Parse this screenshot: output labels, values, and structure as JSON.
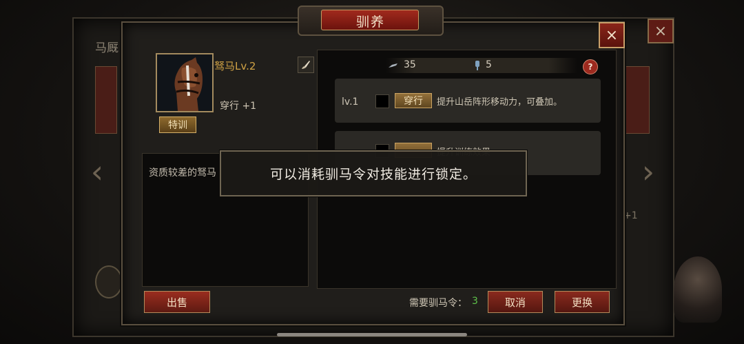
{
  "background": {
    "title": "马厩",
    "close_icon": "×",
    "left_arrow": "‹",
    "right_arrow": "›",
    "stat_fragment": "+1"
  },
  "dialog": {
    "title": "驯养",
    "close_icon": "×"
  },
  "horse": {
    "name": "驽马Lv.2",
    "stat": "穿行 +1",
    "special_button": "特训",
    "description": "资质较差的驽马"
  },
  "resources": [
    {
      "icon": "whip-icon",
      "value": "35"
    },
    {
      "icon": "token-icon",
      "value": "5"
    }
  ],
  "help_icon": "?",
  "brush_icon": "edit-brush-icon",
  "skills": [
    {
      "level": "lv.1",
      "name": "穿行",
      "description": "提升山岳阵形移动力，可叠加。"
    },
    {
      "level": "",
      "name": "",
      "description": "提升训练效果"
    }
  ],
  "footer": {
    "sell": "出售",
    "need_label": "需要驯马令：",
    "need_value": "3",
    "cancel": "取消",
    "replace": "更换"
  },
  "toast": "可以消耗驯马令对技能进行锁定。",
  "colors": {
    "accent_gold": "#d1a345",
    "button_red": "#8a2a1e",
    "green_value": "#5ec34a"
  }
}
